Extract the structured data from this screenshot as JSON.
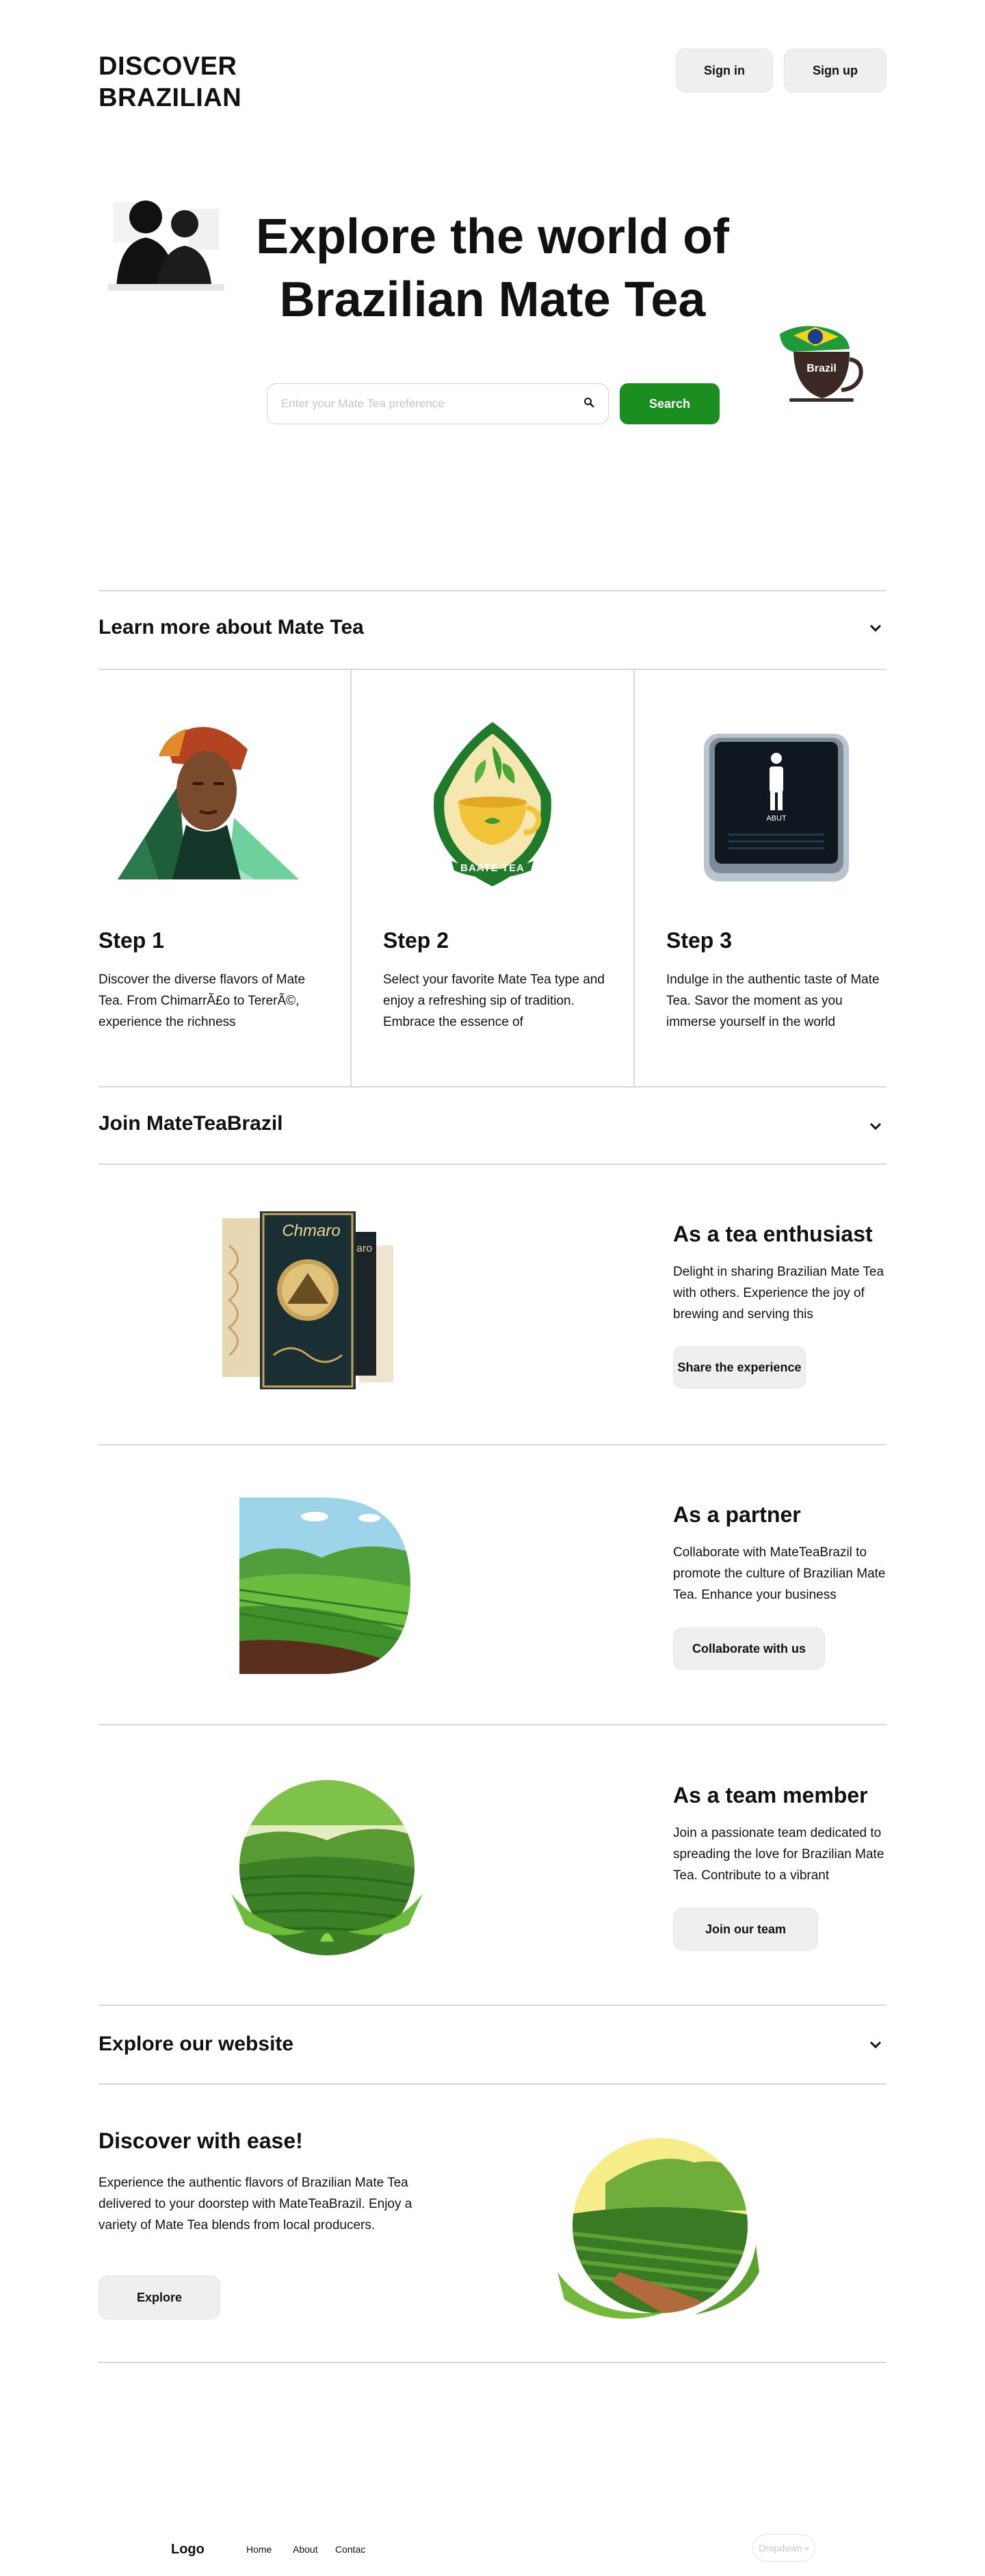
{
  "header": {
    "brand_line1": "DISCOVER",
    "brand_line2": "BRAZILIAN",
    "signin_label": "Sign in",
    "signup_label": "Sign up"
  },
  "hero": {
    "title_line1": "Explore the world of",
    "title_line2": "Brazilian Mate Tea",
    "search_placeholder": "Enter your Mate Tea preference",
    "search_button": "Search",
    "cup_label": "Brazil"
  },
  "learn": {
    "title": "Learn more about Mate Tea",
    "badge_text": "BAATE TEA",
    "sign_text": "ABUT",
    "steps": [
      {
        "title": "Step 1",
        "text": "Discover the diverse flavors of Mate Tea. From ChimarrÃ£o to TererÃ©, experience the richness"
      },
      {
        "title": "Step 2",
        "text": "Select your favorite Mate Tea type and enjoy a refreshing sip of tradition. Embrace the essence of"
      },
      {
        "title": "Step 3",
        "text": "Indulge in the authentic taste of Mate Tea. Savor the moment as you immerse yourself in the world"
      }
    ]
  },
  "join": {
    "title": "Join MateTeaBrazil",
    "package_label": "Chmaro",
    "package_label_back": "aro",
    "roles": [
      {
        "title": "As a tea enthusiast",
        "text": "Delight in sharing Brazilian Mate Tea with others. Experience the joy of brewing and serving this",
        "button": "Share the experience"
      },
      {
        "title": "As a partner",
        "text": "Collaborate with MateTeaBrazil to promote the culture of Brazilian Mate Tea. Enhance your business",
        "button": "Collaborate with us"
      },
      {
        "title": "As a team member",
        "text": "Join a passionate team dedicated to spreading the love for Brazilian Mate Tea. Contribute to a vibrant",
        "button": "Join our team"
      }
    ]
  },
  "explore": {
    "title": "Explore our website",
    "heading": "Discover with ease!",
    "text": "Experience the authentic flavors of Brazilian Mate Tea delivered to your doorstep with MateTeaBrazil. Enjoy a variety of Mate Tea blends from local producers.",
    "button": "Explore"
  },
  "footer": {
    "logo": "Logo",
    "links": [
      "Home",
      "About",
      "Contac"
    ],
    "dropdown": "Dropdown"
  },
  "colors": {
    "accent_green": "#1a8f1f",
    "button_gray": "#efefef",
    "divider": "#d8d8d8"
  }
}
